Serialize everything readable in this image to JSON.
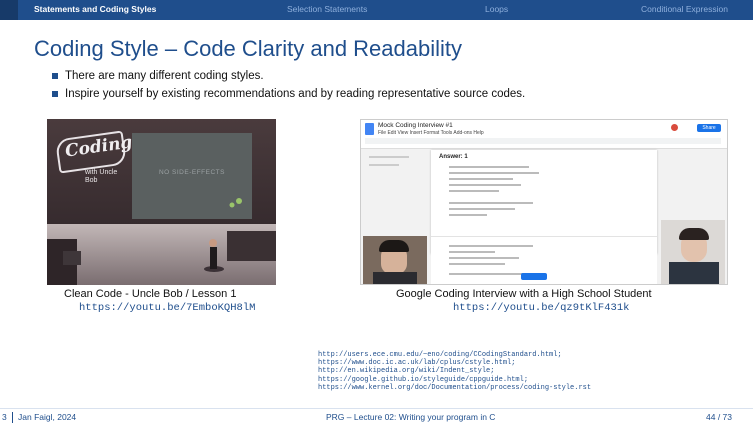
{
  "nav": {
    "left_number": "3",
    "items": [
      {
        "label": "Statements and Coding Styles",
        "active": true
      },
      {
        "label": "Selection Statements",
        "active": false
      },
      {
        "label": "Loops",
        "active": false
      },
      {
        "label": "Conditional Expression",
        "active": false
      }
    ]
  },
  "slide": {
    "title": "Coding Style – Code Clarity and Readability",
    "bullets": [
      "There are many different coding styles.",
      "Inspire yourself by existing recommendations and by reading representative source codes."
    ]
  },
  "video1": {
    "logo_text": "Coding",
    "logo_sub": "with Uncle Bob",
    "screen_text": "NO SIDE-EFFECTS",
    "caption": "Clean Code - Uncle Bob / Lesson 1",
    "url": "https://youtu.be/7EmboKQH8lM"
  },
  "video2": {
    "doc_title": "Mock Coding Interview #1",
    "menu": "File Edit View Insert Format Tools Add-ons Help",
    "share_label": "Share",
    "answer_label": "Answer: 1",
    "caption": "Google Coding Interview with a High School Student",
    "url": "https://youtu.be/qz9tKlF431k"
  },
  "references": [
    "http://users.ece.cmu.edu/~eno/coding/CCodingStandard.html;",
    "https://www.doc.ic.ac.uk/lab/cplus/cstyle.html;",
    "http://en.wikipedia.org/wiki/Indent_style;",
    "https://google.github.io/styleguide/cppguide.html;",
    "https://www.kernel.org/doc/Documentation/process/coding-style.rst"
  ],
  "footer": {
    "author": "Jan Faigl, 2024",
    "lecture": "PRG – Lecture 02: Writing your program in C",
    "page": "44 / 73"
  }
}
